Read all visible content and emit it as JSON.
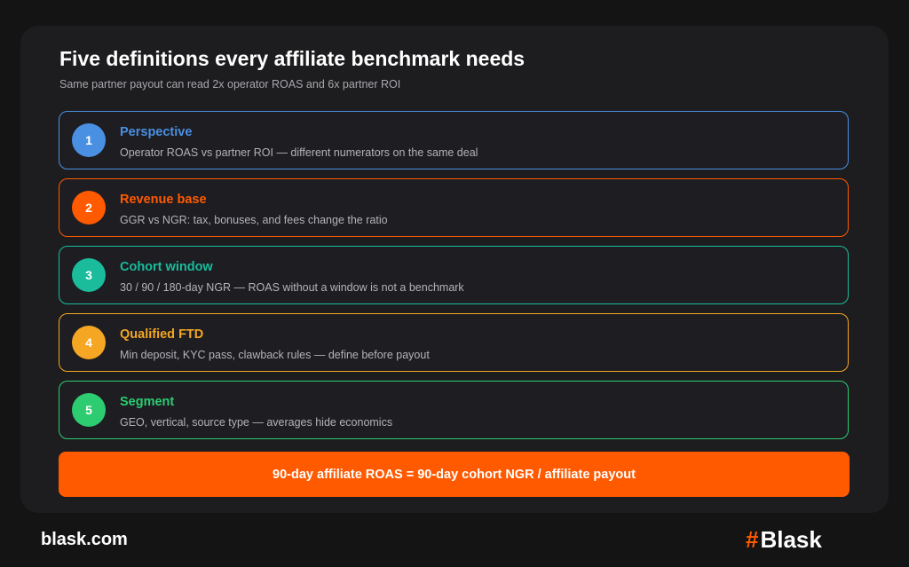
{
  "header": {
    "title": "Five definitions every affiliate benchmark needs",
    "subtitle": "Same partner payout can read 2x operator ROAS and 6x partner ROI"
  },
  "steps": [
    {
      "number": "1",
      "title": "Perspective",
      "description": "Operator ROAS vs partner ROI — different numerators on the same deal",
      "color": "#4a90e2"
    },
    {
      "number": "2",
      "title": "Revenue base",
      "description": "GGR vs NGR: tax, bonuses, and fees change the ratio",
      "color": "#ff5a00"
    },
    {
      "number": "3",
      "title": "Cohort window",
      "description": "30 / 90 / 180-day NGR — ROAS without a window is not a benchmark",
      "color": "#1abc9c"
    },
    {
      "number": "4",
      "title": "Qualified FTD",
      "description": "Min deposit, KYC pass, clawback rules — define before payout",
      "color": "#f5a623"
    },
    {
      "number": "5",
      "title": "Segment",
      "description": "GEO, vertical, source type — averages hide economics",
      "color": "#2ecc71"
    }
  ],
  "formula": {
    "text": "90-day affiliate ROAS = 90-day cohort NGR / affiliate payout",
    "color": "#ff5a00"
  },
  "footer": {
    "site": "blask.com",
    "logo_mark": "#",
    "logo_text": "Blask",
    "logo_icon": "hash-icon"
  }
}
